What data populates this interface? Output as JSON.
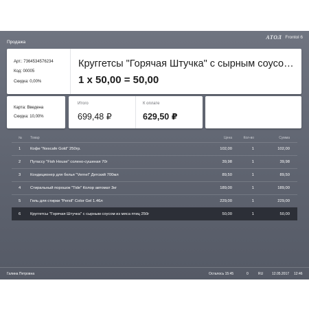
{
  "header": {
    "mode": "Продажа",
    "logo": "АТОЛ",
    "product": "Frontol 6"
  },
  "item": {
    "article": "Арт.: 7364534576234",
    "code": "Код: 00005",
    "discount": "Скидка: 0,00%",
    "name": "Круггетсы \"Горячая Штучка\" с сырным соусом из мяса птиц 250г",
    "calc": "1 x 50,00 = 50,00"
  },
  "card": {
    "state": "Карта: Введена",
    "discount": "Скидка: 10,00%"
  },
  "totals": {
    "total_label": "Итого",
    "total_value": "699,48 ₽",
    "pay_label": "К оплате",
    "pay_value": "629,50 ₽"
  },
  "table": {
    "headers": [
      "№",
      "Товар",
      "Цена",
      "Кол-во",
      "Сумма"
    ],
    "rows": [
      {
        "num": "1",
        "name": "Кофе \"Nescafe Gold\" 250гр.",
        "price": "102,00",
        "qty": "1",
        "sum": "102,00"
      },
      {
        "num": "2",
        "name": "Путассу \"Fish House\" солено-сушеная 70г",
        "price": "39,98",
        "qty": "1",
        "sum": "39,98"
      },
      {
        "num": "3",
        "name": "Кондиционер для белья \"Vernel\" Детский 700мл",
        "price": "89,50",
        "qty": "1",
        "sum": "89,50"
      },
      {
        "num": "4",
        "name": "Стиральный порошок \"Tide\" Колор автомат 3кг",
        "price": "189,00",
        "qty": "1",
        "sum": "189,00"
      },
      {
        "num": "5",
        "name": "Гель для стирки \"Persil\" Color Gel 1.46л",
        "price": "229,00",
        "qty": "1",
        "sum": "229,00"
      },
      {
        "num": "6",
        "name": "Круггетсы \"Горячая Штучка\" с сырным соусом из мяса птиц 250г",
        "price": "50,00",
        "qty": "1",
        "sum": "50,00"
      }
    ],
    "selected_index": 5
  },
  "footer": {
    "cashier": "Галина Петровна",
    "remaining": "Осталось 15:45",
    "counter": "0",
    "lang": "RU",
    "date": "12.05.2017",
    "time": "12:46"
  },
  "colors": {
    "background": "#62676f",
    "selected_row": "#2c2f37",
    "card": "#ffffff"
  }
}
